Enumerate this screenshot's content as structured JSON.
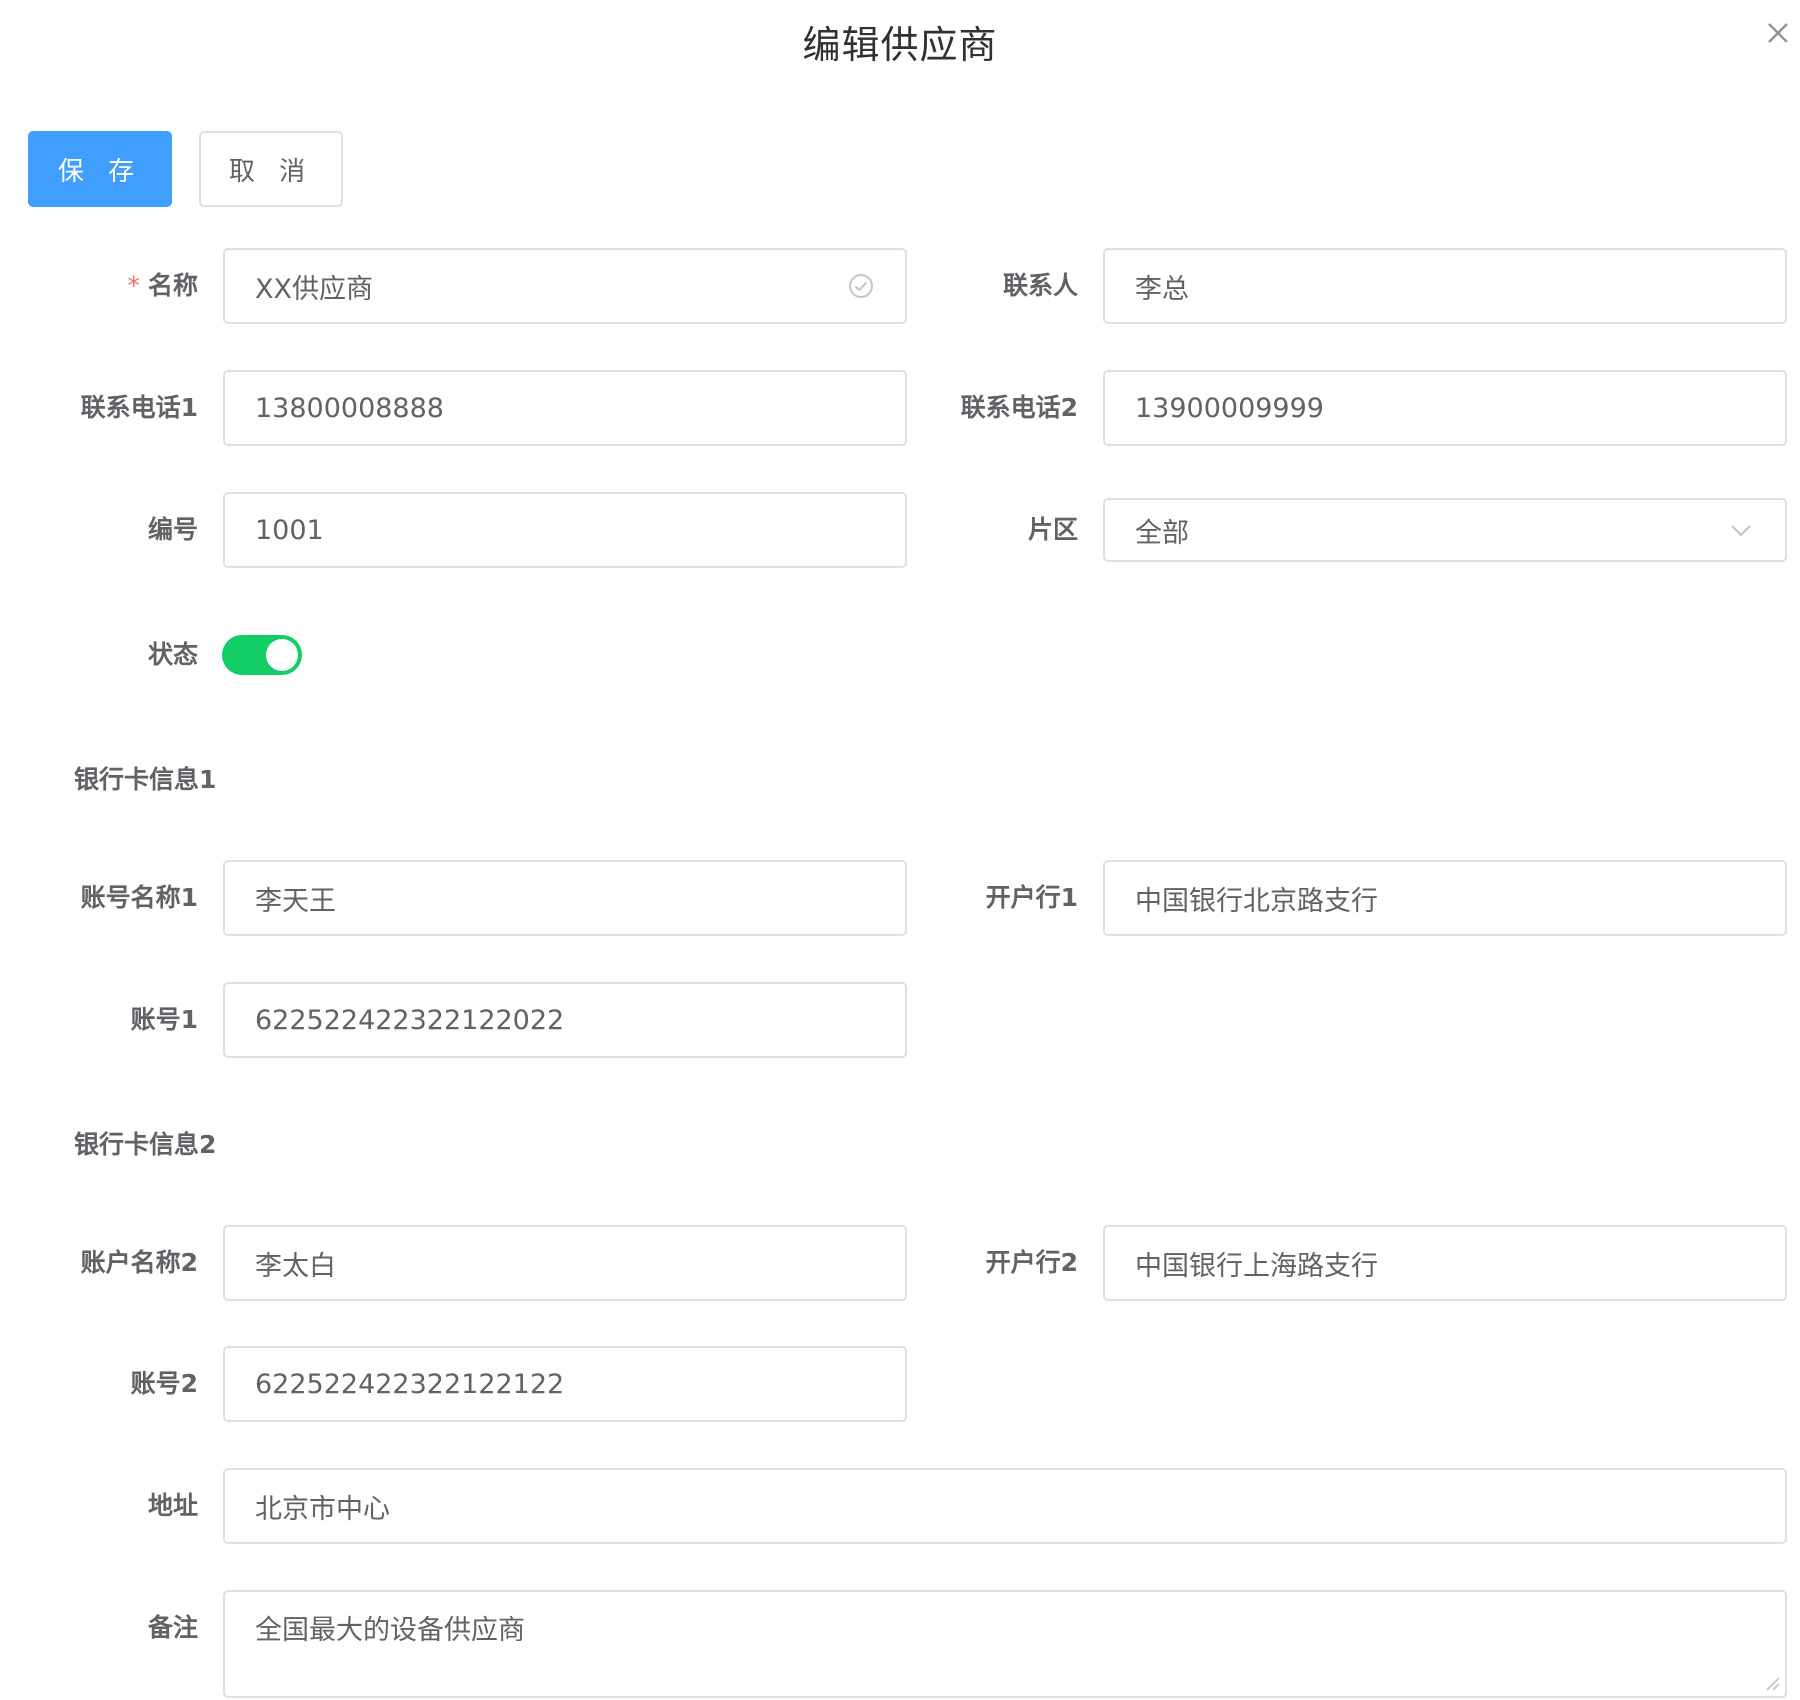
{
  "dialog": {
    "title": "编辑供应商"
  },
  "toolbar": {
    "save_label": "保 存",
    "cancel_label": "取 消"
  },
  "form": {
    "name": {
      "label": "名称",
      "required_mark": "*",
      "value": "XX供应商"
    },
    "contact": {
      "label": "联系人",
      "value": "李总"
    },
    "phone1": {
      "label": "联系电话1",
      "value": "13800008888"
    },
    "phone2": {
      "label": "联系电话2",
      "value": "13900009999"
    },
    "code": {
      "label": "编号",
      "value": "1001"
    },
    "area": {
      "label": "片区",
      "value": "全部"
    },
    "status": {
      "label": "状态",
      "enabled": true,
      "on_color": "#13ce66"
    },
    "bank1": {
      "section_title": "银行卡信息1",
      "account_name": {
        "label": "账号名称1",
        "value": "李天王"
      },
      "bank": {
        "label": "开户行1",
        "value": "中国银行北京路支行"
      },
      "account_no": {
        "label": "账号1",
        "value": "622522422322122022"
      }
    },
    "bank2": {
      "section_title": "银行卡信息2",
      "account_name": {
        "label": "账户名称2",
        "value": "李太白"
      },
      "bank": {
        "label": "开户行2",
        "value": "中国银行上海路支行"
      },
      "account_no": {
        "label": "账号2",
        "value": "622522422322122122"
      }
    },
    "address": {
      "label": "地址",
      "value": "北京市中心"
    },
    "remark": {
      "label": "备注",
      "value": "全国最大的设备供应商"
    }
  },
  "icons": {
    "close": "close-icon",
    "validate": "check-circle-icon",
    "dropdown": "chevron-down-icon",
    "resize": "resize-handle-icon"
  },
  "colors": {
    "primary": "#409eff",
    "success": "#13ce66",
    "danger": "#f56c6c",
    "border": "#dcdfe6"
  }
}
